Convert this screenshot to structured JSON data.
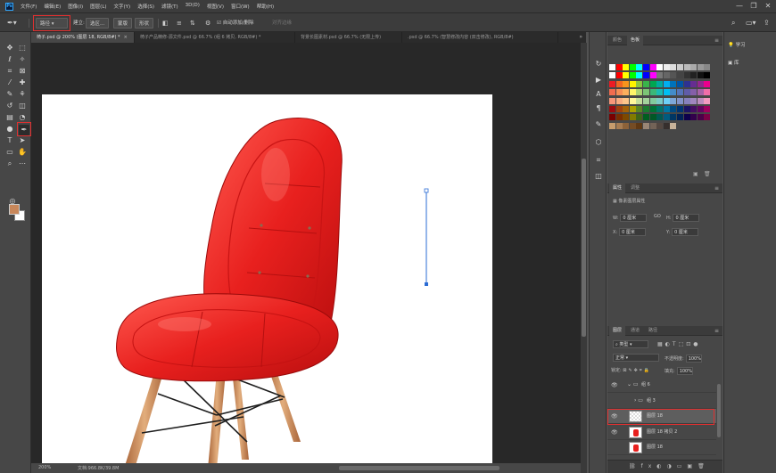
{
  "app": {
    "logo": "Ps",
    "brand_color": "#31a8ff"
  },
  "menu": [
    "文件(F)",
    "编辑(E)",
    "图像(I)",
    "图层(L)",
    "文字(Y)",
    "选择(S)",
    "滤镜(T)",
    "3D(D)",
    "视图(V)",
    "窗口(W)",
    "帮助(H)"
  ],
  "window_controls": {
    "minimize": "—",
    "restore": "❐",
    "close": "✕"
  },
  "options": {
    "tool_mode": "路径",
    "make_label": "建立:",
    "selection_btn": "选区...",
    "mask_btn": "蒙版",
    "shape_btn": "形状",
    "auto_add_delete": "自动添加/删除",
    "align_edges": "对齐边缘"
  },
  "tabs": [
    {
      "label": "椅子.psd @ 200% (图层 18, RGB/8#) *",
      "active": true
    },
    {
      "label": "椅子产品精修-源文件.psd @ 66.7% (组 6 拷贝, RGB/8#) *",
      "active": false
    },
    {
      "label": "背景长图素材.psd @ 66.7% (无限上传)",
      "active": false
    },
    {
      "label": ".psd @ 66.7% (智慧修改内容 (双击修改), RGB/8#)",
      "active": false
    }
  ],
  "status": {
    "zoom": "200%",
    "doc_info": "文档:966.8K/39.8M"
  },
  "swatches": {
    "tabs": [
      "颜色",
      "色板"
    ],
    "rows": [
      [
        "#ffffff",
        "#ff0000",
        "#ffff00",
        "#00ff00",
        "#00ffff",
        "#0000ff",
        "#ff00ff",
        "#ffffff",
        "#eeeeee",
        "#dddddd",
        "#cccccc",
        "#bbbbbb",
        "#aaaaaa",
        "#999999",
        "#888888"
      ],
      [
        "#ffffff",
        "#ff0000",
        "#ffff00",
        "#00ff00",
        "#00ffff",
        "#0000ff",
        "#ff00ff",
        "#777777",
        "#666666",
        "#555555",
        "#444444",
        "#333333",
        "#222222",
        "#111111",
        "#000000"
      ],
      [
        "#ed1c24",
        "#f26522",
        "#f7941d",
        "#fff200",
        "#8dc63f",
        "#39b54a",
        "#00a651",
        "#00a99d",
        "#00aeef",
        "#0072bc",
        "#0054a6",
        "#2e3192",
        "#662d91",
        "#92278f",
        "#ec008c"
      ],
      [
        "#f26c4f",
        "#f68e56",
        "#fbaf5d",
        "#fff568",
        "#acd372",
        "#7cc576",
        "#3bb878",
        "#1abbb4",
        "#00bff3",
        "#438cca",
        "#5574b9",
        "#605ca8",
        "#855fa8",
        "#a763a8",
        "#f06ea9"
      ],
      [
        "#f7977a",
        "#f9ad81",
        "#fdc68a",
        "#fff79a",
        "#c4df9b",
        "#a3d39c",
        "#82ca9d",
        "#7accc8",
        "#6dcff6",
        "#7da7d9",
        "#8393ca",
        "#8781bd",
        "#a186be",
        "#bd8cbf",
        "#f49ac1"
      ],
      [
        "#9e0b0f",
        "#a0410d",
        "#a36209",
        "#aba000",
        "#598527",
        "#1a7b30",
        "#007236",
        "#00746b",
        "#0076a3",
        "#004a80",
        "#003471",
        "#1b1464",
        "#440e62",
        "#630460",
        "#9e005d"
      ],
      [
        "#790000",
        "#7b2e00",
        "#7d4900",
        "#827b00",
        "#406618",
        "#005e20",
        "#005826",
        "#005952",
        "#005b7f",
        "#003663",
        "#002157",
        "#0d004c",
        "#32004b",
        "#4b0049",
        "#7b0046"
      ],
      [
        "#c69c6d",
        "#a67c52",
        "#8c6239",
        "#754c24",
        "#603913",
        "#998675",
        "#736357",
        "#534741",
        "#362f2d",
        "#c7b299"
      ]
    ]
  },
  "properties": {
    "tabs": [
      "属性",
      "调整"
    ],
    "title": "像素图层属性",
    "w_label": "W:",
    "w_value": "0 厘米",
    "link_icon": "GO",
    "h_label": "H:",
    "h_value": "0 厘米",
    "x_label": "X:",
    "x_value": "0 厘米",
    "y_label": "Y:",
    "y_value": "0 厘米"
  },
  "layers": {
    "tabs": [
      "图层",
      "通道",
      "路径"
    ],
    "filter_kind": "类型",
    "blend_mode": "正常",
    "opacity_label": "不透明度:",
    "opacity": "100%",
    "lock_label": "锁定:",
    "fill_label": "填充:",
    "fill": "100%",
    "items": [
      {
        "name": "组 6",
        "type": "group",
        "visible": true,
        "selected": false
      },
      {
        "name": "组 3",
        "type": "group",
        "visible": false,
        "selected": false
      },
      {
        "name": "图层 18",
        "type": "layer",
        "visible": true,
        "selected": true
      },
      {
        "name": "图层 18 拷贝 2",
        "type": "layer",
        "visible": true,
        "selected": false
      },
      {
        "name": "图层 18",
        "type": "layer",
        "visible": false,
        "selected": false
      }
    ]
  },
  "side_panels": [
    {
      "label": "学习"
    },
    {
      "label": "库"
    }
  ],
  "colors": {
    "foreground": "#c8875a",
    "background": "#ffffff",
    "chair_red": "#e8201e",
    "highlight": "#e03030"
  }
}
